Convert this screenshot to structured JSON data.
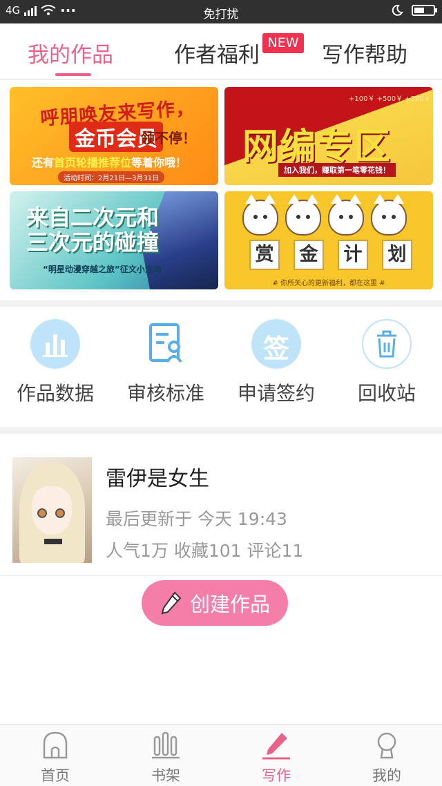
{
  "status_bar": {
    "carrier": "4G",
    "dots": "···",
    "center_text": "免打扰"
  },
  "tabs": [
    {
      "label": "我的作品",
      "active": true
    },
    {
      "label": "作者福利",
      "active": false,
      "badge": "NEW"
    },
    {
      "label": "写作帮助",
      "active": false
    }
  ],
  "banners": [
    {
      "line1": "呼朋唤友来写作，",
      "line2": "金币会员",
      "line3": "领不停！",
      "line4_pre": "还有",
      "line4_hl": "首页轮播推荐位",
      "line4_post": "等着你哦！",
      "line5": "活动时间：2月21日—3月31日"
    },
    {
      "title": "网编专区",
      "subtitle": "加入我们，赚取第一笔零花钱！",
      "amounts": "+100￥  +500￥  +200￥"
    },
    {
      "title_l1": "来自二次元和",
      "title_l2": "三次元的碰撞",
      "subtitle": "“明星动漫穿越之旅”征文小活动"
    },
    {
      "chars": [
        "赏",
        "金",
        "计",
        "划"
      ],
      "subtitle": "# 你所关心的更新福利，都在这里 #"
    }
  ],
  "quick_actions": [
    {
      "label": "作品数据",
      "icon": "bar-chart-icon",
      "color": "#bfe3f8"
    },
    {
      "label": "审核标准",
      "icon": "document-icon",
      "color": "#ffffff"
    },
    {
      "label": "申请签约",
      "icon": "sign-icon",
      "color": "#bfe3f8",
      "icon_text": "签"
    },
    {
      "label": "回收站",
      "icon": "trash-icon",
      "color": "#ffffff"
    }
  ],
  "book": {
    "title": "雷伊是女生",
    "updated": "最后更新于 今天 19:43",
    "stats": "人气1万 收藏101 评论11"
  },
  "create_button": {
    "label": "创建作品"
  },
  "bottom_nav": [
    {
      "label": "首页",
      "icon": "home-icon",
      "active": false
    },
    {
      "label": "书架",
      "icon": "bookshelf-icon",
      "active": false
    },
    {
      "label": "写作",
      "icon": "pen-icon",
      "active": true
    },
    {
      "label": "我的",
      "icon": "profile-icon",
      "active": false
    }
  ],
  "colors": {
    "accent": "#e96389",
    "create_button": "#f57ea8",
    "icon_blue": "#5aaee8"
  }
}
